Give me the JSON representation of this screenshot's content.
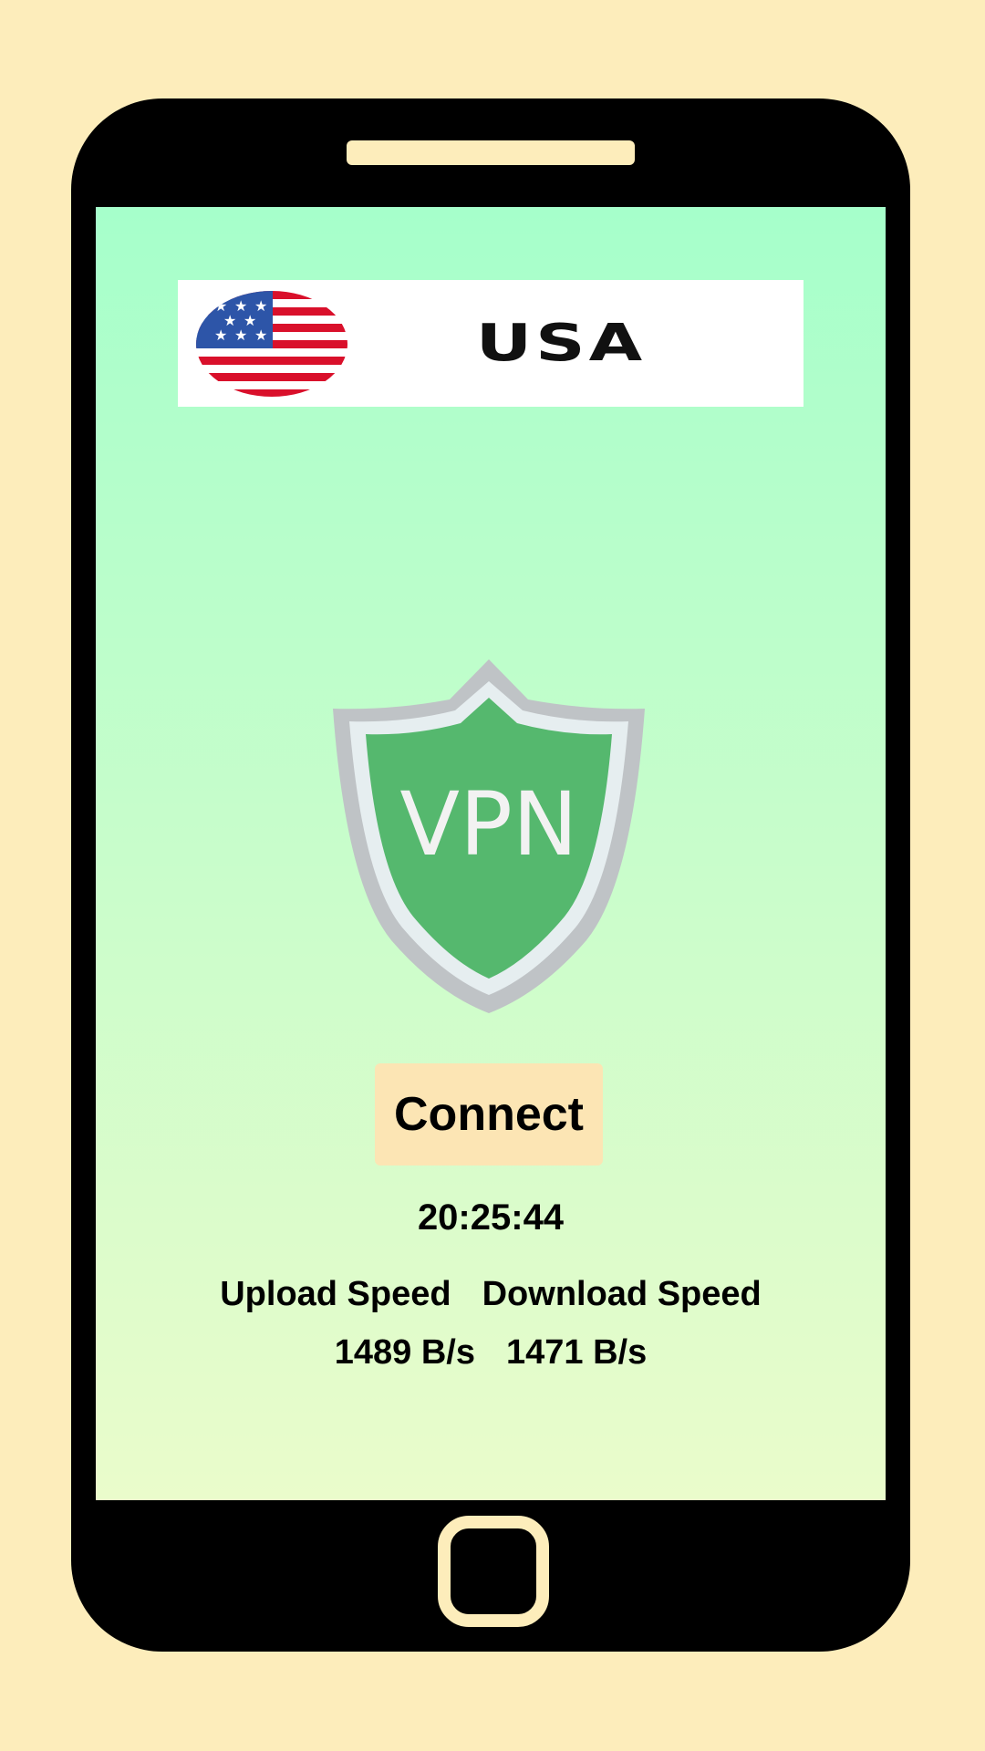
{
  "country": {
    "name": "USA",
    "flag_icon": "usa-flag-icon"
  },
  "shield": {
    "icon": "vpn-shield-icon",
    "label": "VPN"
  },
  "connect_button": {
    "label": "Connect"
  },
  "timer": {
    "value": "20:25:44"
  },
  "stats": {
    "upload_label": "Upload Speed",
    "download_label": "Download Speed",
    "upload_value": "1489 B/s",
    "download_value": "1471 B/s"
  },
  "colors": {
    "background": "#FDEDBB",
    "phone_body": "#000000",
    "screen_top": "#A6FFCB",
    "screen_bottom": "#EAFCCB",
    "shield_green": "#55B86E",
    "shield_rim": "#BFC3C6",
    "connect_button": "#FCE5B4"
  }
}
